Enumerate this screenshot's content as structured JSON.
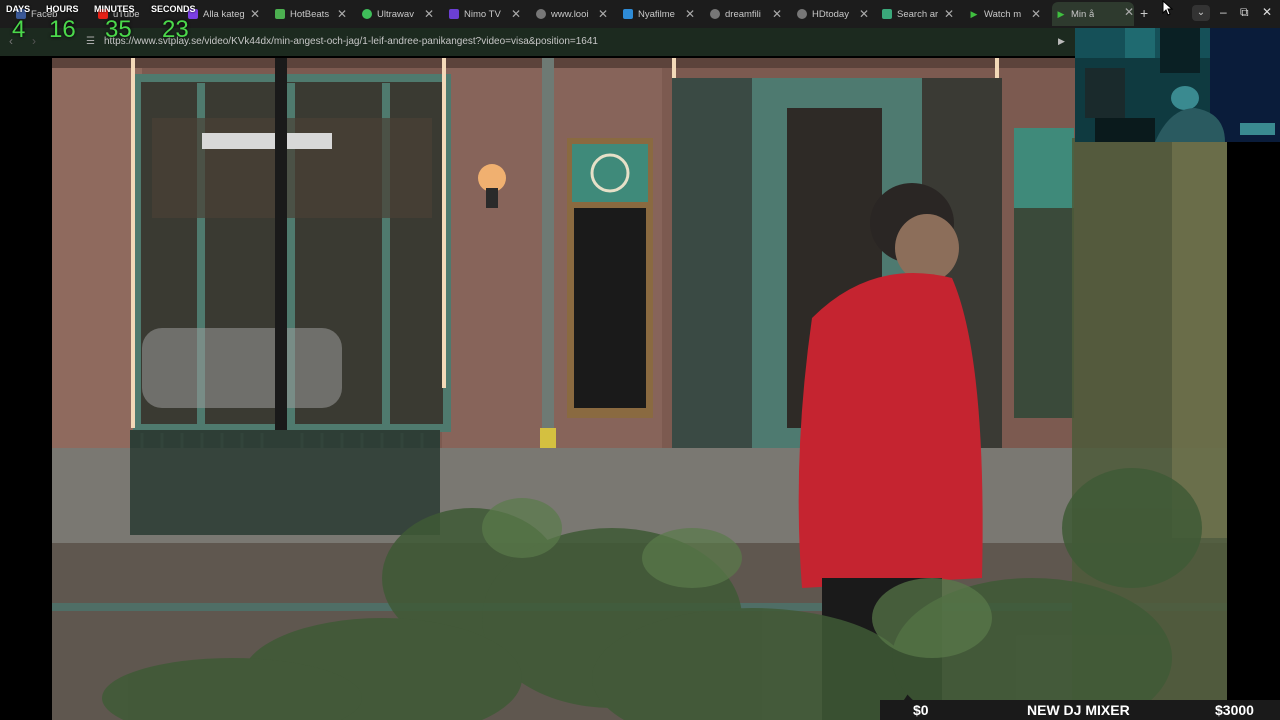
{
  "browser": {
    "tabs": [
      {
        "label": "Faceb",
        "color": "#3b5998"
      },
      {
        "label": "uTube",
        "color": "#e62117"
      },
      {
        "label": "Alla kateg",
        "color": "#7b3fe4"
      },
      {
        "label": "HotBeats",
        "color": "#4caf50"
      },
      {
        "label": "Ultrawav",
        "color": "#3fbf5a"
      },
      {
        "label": "Nimo TV",
        "color": "#6b3fd4"
      },
      {
        "label": "www.looi",
        "color": "#777777"
      },
      {
        "label": "Nyafilme",
        "color": "#2e8bd6"
      },
      {
        "label": "dreamfili",
        "color": "#777777"
      },
      {
        "label": "HDtoday",
        "color": "#777777"
      },
      {
        "label": "Search ar",
        "color": "#3aa87a"
      },
      {
        "label": "Watch m",
        "color": "#3fbf3f"
      },
      {
        "label": "Min å",
        "color": "#3fbf3f",
        "active": true
      }
    ],
    "new_tab": "+",
    "tab_menu": "⌄",
    "url": "https://www.svtplay.se/video/KVk44dx/min-angest-och-jag/1-leif-andree-panikangest?video=visa&position=1641",
    "window": {
      "minimize": "–",
      "restore": "⧉",
      "close": "✕"
    }
  },
  "countdown": {
    "days_label": "DAYS",
    "hours_label": "HOURS",
    "minutes_label": "MINUTES",
    "seconds_label": "SECONDS",
    "days": "4",
    "hours": "16",
    "minutes": "35",
    "seconds": "23"
  },
  "donation_bar": {
    "current": "$0",
    "goal_label": "NEW DJ MIXER",
    "goal": "$3000"
  }
}
